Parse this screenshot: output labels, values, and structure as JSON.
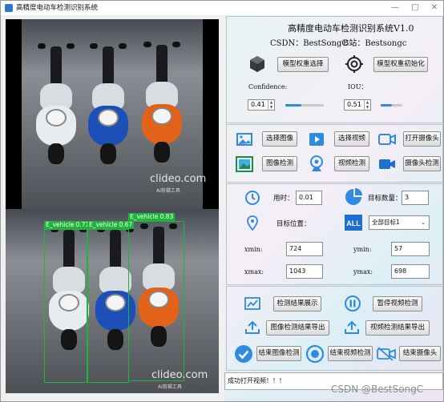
{
  "window": {
    "title": "高精度电动车检测识别系统",
    "controls": {
      "minimize": "—",
      "maximize": "□",
      "close": "✕"
    }
  },
  "header": {
    "title": "高精度电动车检测识别系统V1.0",
    "csdn": "CSDN：BestSongC",
    "bili": "B站：Bestsongc"
  },
  "model": {
    "select_btn": "模型权重选择",
    "init_btn": "模型权重初始化",
    "confidence_label": "Confidence:",
    "confidence_value": "0.41",
    "iou_label": "IOU：",
    "iou_value": "0.51",
    "confidence_level": 0.41,
    "iou_level": 0.51
  },
  "actions": {
    "select_image": "选择图像",
    "select_video": "选择视频",
    "open_camera": "打开摄像头",
    "image_detect": "图像检测",
    "video_detect": "视频检测",
    "camera_detect": "摄像头检测"
  },
  "results": {
    "time_label": "用时：",
    "time_value": "0.01",
    "count_label": "目标数量：",
    "count_value": "3",
    "position_label": "目标位置：",
    "target_select": "全部目标1",
    "xmin_label": "xmin:",
    "xmin_value": "724",
    "ymin_label": "ymin:",
    "ymin_value": "57",
    "xmax_label": "xmax:",
    "xmax_value": "1043",
    "ymax_label": "ymax:",
    "ymax_value": "698"
  },
  "bottom": {
    "show_results": "检测结果展示",
    "pause_video": "暂停视频检测",
    "export_image": "图像检测结果导出",
    "export_video": "视频检测结果导出",
    "end_image": "结束图像检测",
    "end_video": "结束视频检测",
    "end_camera": "结束摄像头"
  },
  "status": "成功打开视频！！！",
  "images": {
    "watermark": "clideo.com",
    "watermark_sub": "AI剪辑工具",
    "detections": [
      {
        "label": "E_vehicle  0.71"
      },
      {
        "label": "E_vehicle  0.67"
      },
      {
        "label": "E_vehicle  0.83"
      }
    ]
  },
  "page_watermark": "CSDN @BestSongC",
  "colors": {
    "accent_blue": "#2f8be0",
    "detect_green": "#1fb43a",
    "scooter_white": "#e9ecef",
    "scooter_blue": "#1c4fb8",
    "scooter_orange": "#e2621a"
  }
}
